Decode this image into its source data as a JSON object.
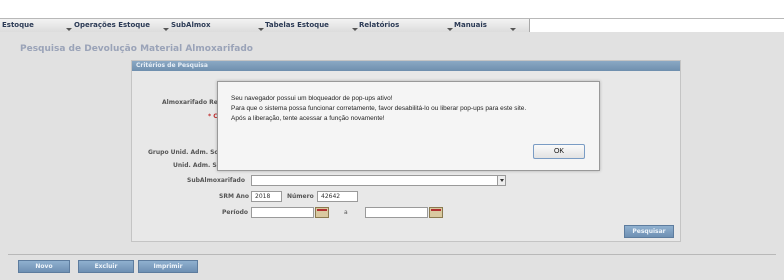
{
  "menu": {
    "items": [
      {
        "label": "Estoque"
      },
      {
        "label": "Operações Estoque"
      },
      {
        "label": "SubAlmox"
      },
      {
        "label": "Tabelas Estoque"
      },
      {
        "label": "Relatórios"
      },
      {
        "label": "Manuais"
      }
    ]
  },
  "page": {
    "title": "Pesquisa de Devolução Material Almoxarifado"
  },
  "criteria": {
    "header": "Critérios de Pesquisa",
    "almox_label": "Almoxarifado Re",
    "required_label": "* C",
    "grupo_label": "Grupo Unid. Adm. Sc",
    "unid_label": "Unid. Adm. Sc",
    "subalmox_label": "SubAlmoxarifado",
    "subalmox_value": "",
    "srm_ano_label": "SRM Ano",
    "srm_ano_value": "2018",
    "numero_label": "Número",
    "numero_value": "42642",
    "periodo_label": "Período",
    "periodo_sep": "a",
    "periodo_start": "",
    "periodo_end": "",
    "pesquisar_label": "Pesquisar"
  },
  "actions": {
    "novo_label": "Novo",
    "excluir_label": "Excluir",
    "imprimir_label": "Imprimir"
  },
  "dialog": {
    "line1": "Seu navegador possui um bloqueador de pop-ups ativo!",
    "line2": "Para que o sistema possa funcionar corretamente, favor desabilitá-lo ou liberar pop-ups para este site.",
    "line3": "Após a liberação, tente acessar a função novamente!",
    "ok_label": "OK"
  }
}
